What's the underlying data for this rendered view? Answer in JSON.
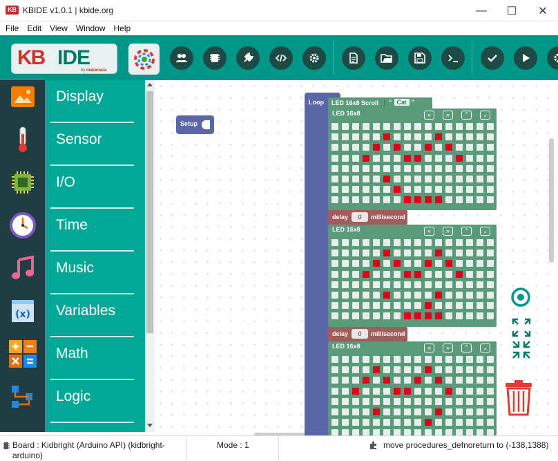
{
  "window": {
    "title": "KBIDE v1.0.1 | kbide.org",
    "logo_text": "KB",
    "minimize": "—",
    "maximize": "☐",
    "close": "✕"
  },
  "menu": [
    "File",
    "Edit",
    "View",
    "Window",
    "Help"
  ],
  "brand": {
    "kb": "KB",
    "ide": "IDE",
    "by": "by ",
    "maker": "makerasia"
  },
  "toolbar_icons": [
    "users-icon",
    "chip-icon",
    "plug-icon",
    "code-icon",
    "gear-icon",
    "new-file-icon",
    "open-folder-icon",
    "save-icon",
    "terminal-icon",
    "check-icon",
    "play-icon",
    "settings-icon"
  ],
  "categories": [
    {
      "label": "Display",
      "icon": "display-icon"
    },
    {
      "label": "Sensor",
      "icon": "thermometer-icon"
    },
    {
      "label": "I/O",
      "icon": "chip-icon"
    },
    {
      "label": "Time",
      "icon": "clock-icon"
    },
    {
      "label": "Music",
      "icon": "music-note-icon"
    },
    {
      "label": "Variables",
      "icon": "variable-icon"
    },
    {
      "label": "Math",
      "icon": "math-icon"
    },
    {
      "label": "Logic",
      "icon": "logic-icon"
    }
  ],
  "blocks": {
    "setup": "Setup",
    "loop": "Loop",
    "scroll": {
      "label": "LED 16x8 Scroll",
      "open_quote": "“",
      "text": "Cat",
      "close_quote": "”"
    },
    "led_title": "LED 16x8",
    "led_controls": [
      "«",
      "»",
      "⌃",
      "⌄"
    ],
    "delay": {
      "label": "delay",
      "value": "0",
      "unit": "millisecond"
    },
    "led_frames": [
      {
        "on": [
          [
            1,
            5
          ],
          [
            1,
            10
          ],
          [
            2,
            4
          ],
          [
            2,
            6
          ],
          [
            2,
            9
          ],
          [
            2,
            11
          ],
          [
            3,
            3
          ],
          [
            3,
            7
          ],
          [
            3,
            8
          ],
          [
            3,
            12
          ],
          [
            5,
            5
          ],
          [
            6,
            6
          ],
          [
            7,
            7
          ],
          [
            7,
            8
          ],
          [
            7,
            9
          ],
          [
            7,
            10
          ]
        ]
      },
      {
        "on": [
          [
            1,
            5
          ],
          [
            1,
            10
          ],
          [
            2,
            4
          ],
          [
            2,
            6
          ],
          [
            2,
            9
          ],
          [
            2,
            11
          ],
          [
            3,
            3
          ],
          [
            3,
            7
          ],
          [
            3,
            8
          ],
          [
            3,
            12
          ],
          [
            5,
            5
          ],
          [
            5,
            10
          ],
          [
            6,
            9
          ],
          [
            7,
            7
          ],
          [
            7,
            8
          ],
          [
            7,
            9
          ],
          [
            7,
            10
          ]
        ]
      },
      {
        "on": [
          [
            1,
            4
          ],
          [
            1,
            9
          ],
          [
            2,
            3
          ],
          [
            2,
            5
          ],
          [
            2,
            8
          ],
          [
            2,
            10
          ],
          [
            3,
            2
          ],
          [
            3,
            6
          ],
          [
            3,
            7
          ],
          [
            3,
            11
          ],
          [
            5,
            4
          ],
          [
            5,
            10
          ],
          [
            6,
            9
          ]
        ]
      }
    ]
  },
  "status": {
    "board": "Board : Kidbright (Arduino API) (kidbright-arduino)",
    "mode": "Mode : 1",
    "message": "move procedures_defnoreturn to (-138,1388)"
  }
}
